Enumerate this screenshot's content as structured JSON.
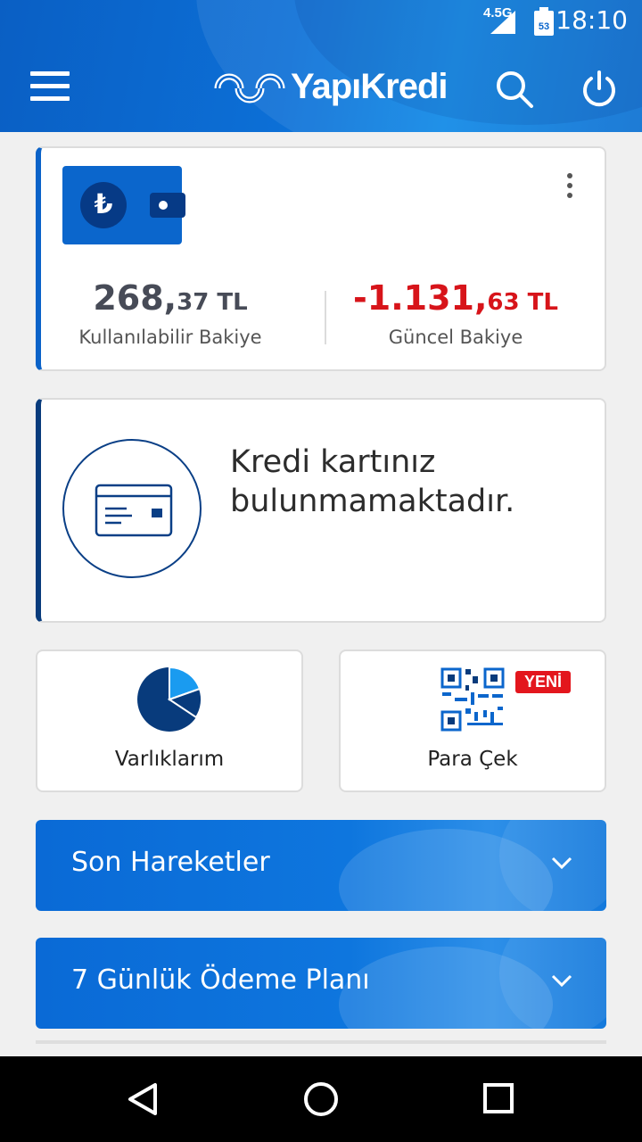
{
  "status_bar": {
    "network": "4.5G",
    "battery_level": "53",
    "time": "18:10"
  },
  "header": {
    "logo_text": "YapıKredi",
    "icons": [
      "menu-icon",
      "search-icon",
      "power-icon"
    ]
  },
  "account_card": {
    "currency_symbol": "₺",
    "available_balance": {
      "main": "268,",
      "cents": "37 TL",
      "label": "Kullanılabilir Bakiye"
    },
    "current_balance": {
      "main": "-1.131,",
      "cents": "63 TL",
      "label": "Güncel Bakiye"
    }
  },
  "credit_card": {
    "message": "Kredi kartınız bulunmamaktadır."
  },
  "tiles": [
    {
      "label": "Varlıklarım",
      "icon": "pie-chart-icon"
    },
    {
      "label": "Para Çek",
      "icon": "qr-code-icon",
      "badge": "YENİ"
    }
  ],
  "accordions": [
    {
      "label": "Son Hareketler"
    },
    {
      "label": "7 Günlük Ödeme Planı"
    }
  ],
  "colors": {
    "brand_blue": "#0b66cc",
    "dark_navy": "#083b7c",
    "negative_red": "#d7141a",
    "badge_red": "#e3161d"
  }
}
